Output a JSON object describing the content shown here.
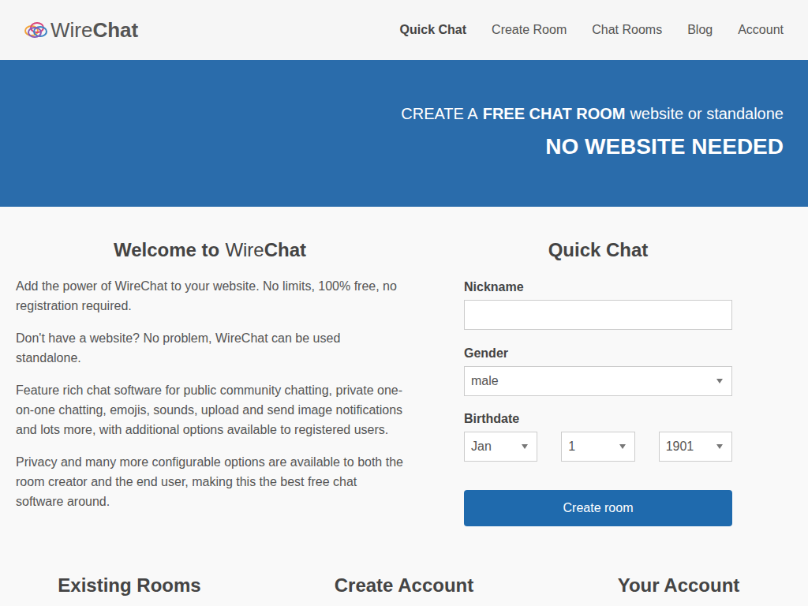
{
  "logo": {
    "part1": "Wire",
    "part2": "Chat"
  },
  "nav": [
    {
      "label": "Quick Chat",
      "selected": true
    },
    {
      "label": "Create Room",
      "selected": false
    },
    {
      "label": "Chat Rooms",
      "selected": false
    },
    {
      "label": "Blog",
      "selected": false
    },
    {
      "label": "Account",
      "selected": false
    }
  ],
  "hero": {
    "line1": [
      {
        "text": "CREATE A",
        "bold": false
      },
      {
        "text": "FREE CHAT ROOM",
        "bold": true
      },
      {
        "text": "website or standalone",
        "bold": false
      }
    ],
    "line2": "NO WEBSITE NEEDED"
  },
  "welcome": {
    "title": [
      {
        "text": "Welcome to",
        "bold": true
      },
      {
        "text": "Wire",
        "bold": false
      },
      {
        "text": "Chat",
        "bold": true
      }
    ],
    "paragraphs": [
      "Add the power of WireChat to your website. No limits, 100% free, no registration required.",
      "Don't have a website? No problem, WireChat can be used standalone.",
      "Feature rich chat software for public community chatting, private one-on-one chatting, emojis, sounds, upload and send image notifications and lots more, with additional options available to registered users.",
      "Privacy and many more configurable options are available to both the room creator and the end user, making this the best free chat software around."
    ]
  },
  "quick_chat": {
    "title": "Quick Chat",
    "nickname": {
      "label": "Nickname",
      "value": ""
    },
    "gender": {
      "label": "Gender",
      "value": "male"
    },
    "birthdate": {
      "label": "Birthdate",
      "month": "Jan",
      "day": "1",
      "year": "1901"
    },
    "button": "Create room"
  },
  "sections": [
    "Existing Rooms",
    "Create Account",
    "Your Account"
  ]
}
